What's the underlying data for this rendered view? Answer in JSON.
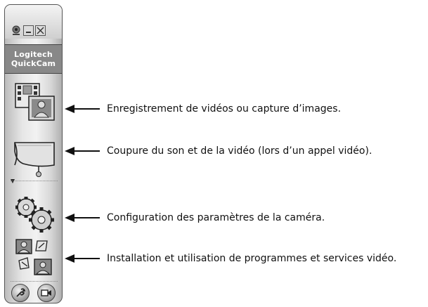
{
  "toolbar": {
    "logo_line1": "Logitech",
    "logo_line2": "QuickCam",
    "buttons": [
      {
        "icon": "video-capture-icon",
        "callout": "Enregistrement de vidéos ou capture d’images."
      },
      {
        "icon": "privacy-shade-icon",
        "callout": "Coupure du son et de la vidéo (lors d’un appel vidéo)."
      },
      {
        "icon": "gears-icon",
        "callout": "Configuration des paramètres de la caméra."
      },
      {
        "icon": "video-programs-icon",
        "callout": "Installation et utilisation de programmes et services vidéo."
      }
    ]
  }
}
